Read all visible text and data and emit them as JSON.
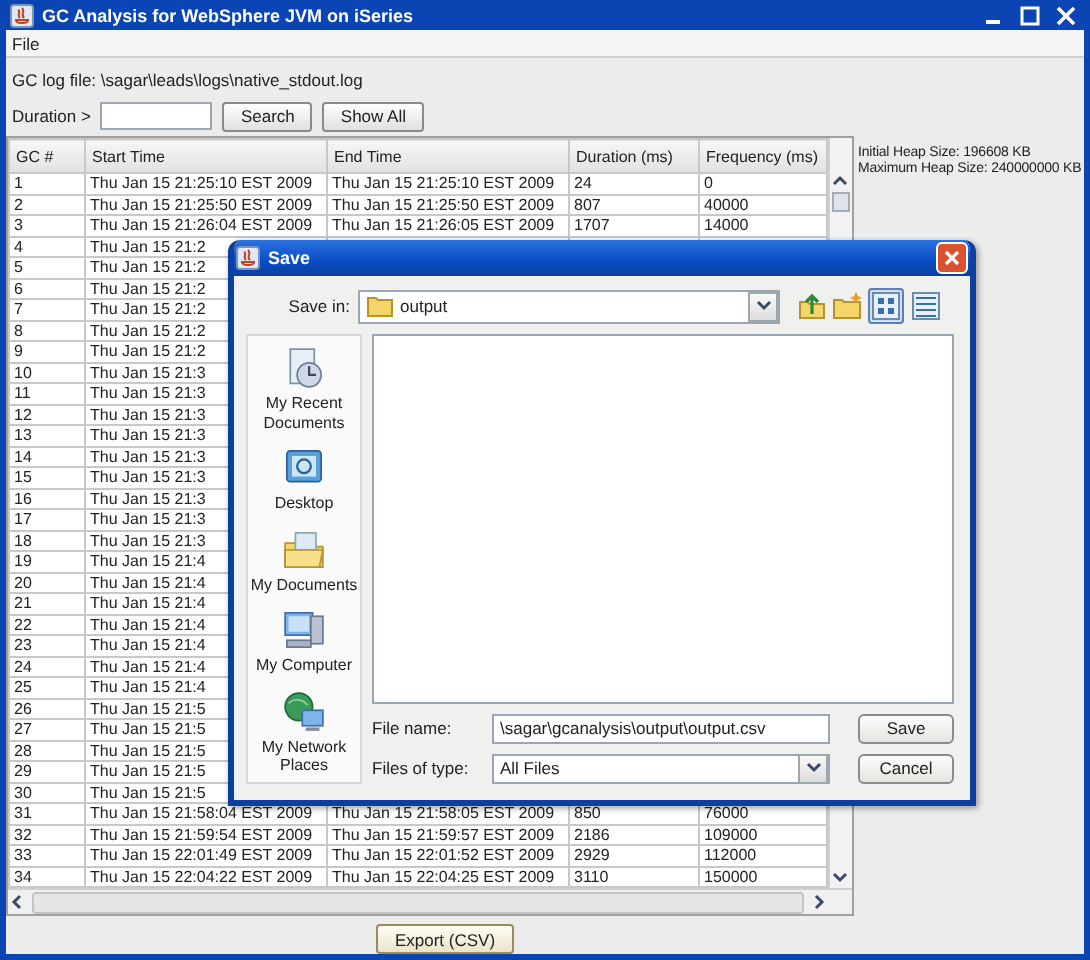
{
  "window": {
    "title": "GC Analysis for WebSphere JVM on iSeries"
  },
  "menu": [
    "File"
  ],
  "log_file": "GC log file:  \\sagar\\leads\\logs\\native_stdout.log",
  "filter": {
    "label": "Duration >",
    "buttons": [
      "Search",
      "Show All"
    ]
  },
  "table": {
    "columns": [
      "GC #",
      "Start Time",
      "End Time",
      "Duration (ms)",
      "Frequency (ms)"
    ],
    "rows": [
      {
        "cells": [
          "1",
          "Thu Jan 15 21:25:10 EST 2009",
          "Thu Jan 15 21:25:10 EST 2009",
          "24",
          "0"
        ]
      },
      {
        "cells": [
          "2",
          "Thu Jan 15 21:25:50 EST 2009",
          "Thu Jan 15 21:25:50 EST 2009",
          "807",
          "40000"
        ]
      },
      {
        "cells": [
          "3",
          "Thu Jan 15 21:26:04 EST 2009",
          "Thu Jan 15 21:26:05 EST 2009",
          "1707",
          "14000"
        ]
      },
      {
        "cells": [
          "4",
          "Thu Jan 15 21:2"
        ]
      },
      {
        "cells": [
          "5",
          "Thu Jan 15 21:2"
        ]
      },
      {
        "cells": [
          "6",
          "Thu Jan 15 21:2"
        ]
      },
      {
        "cells": [
          "7",
          "Thu Jan 15 21:2"
        ]
      },
      {
        "cells": [
          "8",
          "Thu Jan 15 21:2"
        ]
      },
      {
        "cells": [
          "9",
          "Thu Jan 15 21:2"
        ]
      },
      {
        "cells": [
          "10",
          "Thu Jan 15 21:3"
        ]
      },
      {
        "cells": [
          "11",
          "Thu Jan 15 21:3"
        ]
      },
      {
        "cells": [
          "12",
          "Thu Jan 15 21:3"
        ]
      },
      {
        "cells": [
          "13",
          "Thu Jan 15 21:3"
        ]
      },
      {
        "cells": [
          "14",
          "Thu Jan 15 21:3"
        ]
      },
      {
        "cells": [
          "15",
          "Thu Jan 15 21:3"
        ]
      },
      {
        "cells": [
          "16",
          "Thu Jan 15 21:3"
        ]
      },
      {
        "cells": [
          "17",
          "Thu Jan 15 21:3"
        ]
      },
      {
        "cells": [
          "18",
          "Thu Jan 15 21:3"
        ]
      },
      {
        "cells": [
          "19",
          "Thu Jan 15 21:4"
        ]
      },
      {
        "cells": [
          "20",
          "Thu Jan 15 21:4"
        ]
      },
      {
        "cells": [
          "21",
          "Thu Jan 15 21:4"
        ]
      },
      {
        "cells": [
          "22",
          "Thu Jan 15 21:4"
        ]
      },
      {
        "cells": [
          "23",
          "Thu Jan 15 21:4"
        ]
      },
      {
        "cells": [
          "24",
          "Thu Jan 15 21:4"
        ]
      },
      {
        "cells": [
          "25",
          "Thu Jan 15 21:4"
        ]
      },
      {
        "cells": [
          "26",
          "Thu Jan 15 21:5"
        ]
      },
      {
        "cells": [
          "27",
          "Thu Jan 15 21:5"
        ]
      },
      {
        "cells": [
          "28",
          "Thu Jan 15 21:5"
        ]
      },
      {
        "cells": [
          "29",
          "Thu Jan 15 21:5"
        ]
      },
      {
        "cells": [
          "30",
          "Thu Jan 15 21:5"
        ]
      },
      {
        "cells": [
          "31",
          "Thu Jan 15 21:58:04 EST 2009",
          "Thu Jan 15 21:58:05 EST 2009",
          "850",
          "76000"
        ]
      },
      {
        "cells": [
          "32",
          "Thu Jan 15 21:59:54 EST 2009",
          "Thu Jan 15 21:59:57 EST 2009",
          "2186",
          "109000"
        ]
      },
      {
        "cells": [
          "33",
          "Thu Jan 15 22:01:49 EST 2009",
          "Thu Jan 15 22:01:52 EST 2009",
          "2929",
          "112000"
        ]
      },
      {
        "cells": [
          "34",
          "Thu Jan 15 22:04:22 EST 2009",
          "Thu Jan 15 22:04:25 EST 2009",
          "3110",
          "150000"
        ]
      }
    ]
  },
  "heap_info": [
    "Initial Heap Size: 196608 KB",
    "Maximum Heap Size: 240000000 KB"
  ],
  "export_button": "Export (CSV)",
  "dialog": {
    "title": "Save",
    "save_in_label": "Save in:",
    "save_in_value": "output",
    "view_modes": [
      {
        "kind": "list",
        "selected": true
      },
      {
        "kind": "details",
        "selected": false
      }
    ],
    "places": [
      {
        "kind": "recent",
        "label": "My Recent Documents"
      },
      {
        "kind": "desktop",
        "label": "Desktop"
      },
      {
        "kind": "documents",
        "label": "My Documents"
      },
      {
        "kind": "computer",
        "label": "My Computer"
      },
      {
        "kind": "network",
        "label": "My Network Places"
      }
    ],
    "file_name_label": "File name:",
    "file_name_value": "\\sagar\\gcanalysis\\output\\output.csv",
    "file_type_label": "Files of type:",
    "file_type_value": "All Files",
    "buttons": [
      "Save",
      "Cancel"
    ]
  }
}
